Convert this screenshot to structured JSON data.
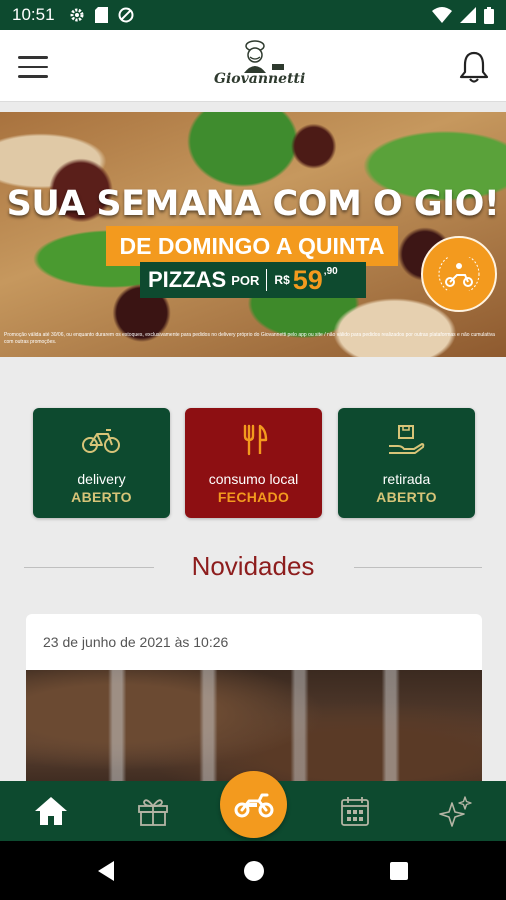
{
  "status_bar": {
    "time": "10:51"
  },
  "header": {
    "logo_text": "Giovannetti"
  },
  "banner": {
    "title": "SUA SEMANA COM O GIO!",
    "subtitle": "DE DOMINGO A QUINTA",
    "price_label": "PIZZAS",
    "price_connector": "POR",
    "currency": "R$",
    "price_value": "59",
    "price_cents": ",90",
    "disclaimer": "Promoção válida até 30/06, ou enquanto durarem os estoques, exclusivamente para pedidos no delivery próprio do Giovannetti pelo app ou site / não válido para pedidos realizados por outras plataformas e não cumulativa com outras promoções."
  },
  "services": [
    {
      "label": "delivery",
      "status": "ABERTO",
      "icon": "bicycle-icon"
    },
    {
      "label": "consumo local",
      "status": "FECHADO",
      "icon": "fork-knife-icon"
    },
    {
      "label": "retirada",
      "status": "ABERTO",
      "icon": "package-hand-icon"
    }
  ],
  "news": {
    "title": "Novidades",
    "card_date": "23 de junho de 2021 às 10:26"
  },
  "bottom_nav": {
    "items": [
      "home-icon",
      "gift-icon",
      "motorcycle-icon",
      "calendar-icon",
      "sparkles-icon"
    ]
  },
  "colors": {
    "brand_green": "#0d4a2f",
    "brand_red": "#8d0f12",
    "accent_orange": "#f39a1e",
    "news_title": "#8d1d1d"
  }
}
